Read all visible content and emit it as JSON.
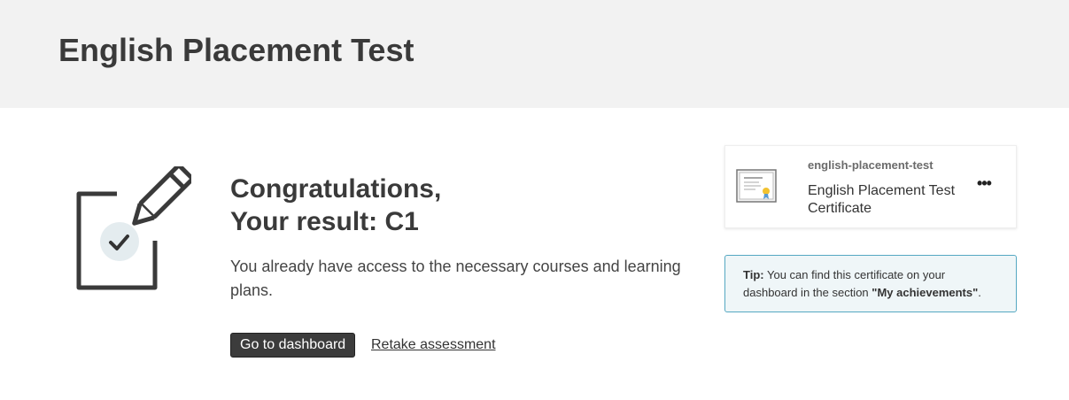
{
  "header": {
    "title": "English Placement Test"
  },
  "result": {
    "line1": "Congratulations,",
    "line2": "Your result: C1",
    "message": "You already have access to the necessary courses and learning plans."
  },
  "actions": {
    "dashboard_label": "Go to dashboard",
    "retake_label": "Retake assessment"
  },
  "certificate": {
    "slug": "english-placement-test",
    "name": "English Placement Test Certificate",
    "more_icon": "more-horizontal-icon",
    "thumb_icon": "certificate-icon"
  },
  "tip": {
    "prefix": "Tip:",
    "text": "You can find this certificate on your dashboard in the section",
    "section": "\"My achievements\"",
    "suffix": "."
  },
  "colors": {
    "header_bg": "#f2f2f2",
    "primary_button": "#3c3c3c",
    "tip_border": "#55a8c2",
    "tip_bg": "#eff6f8"
  }
}
